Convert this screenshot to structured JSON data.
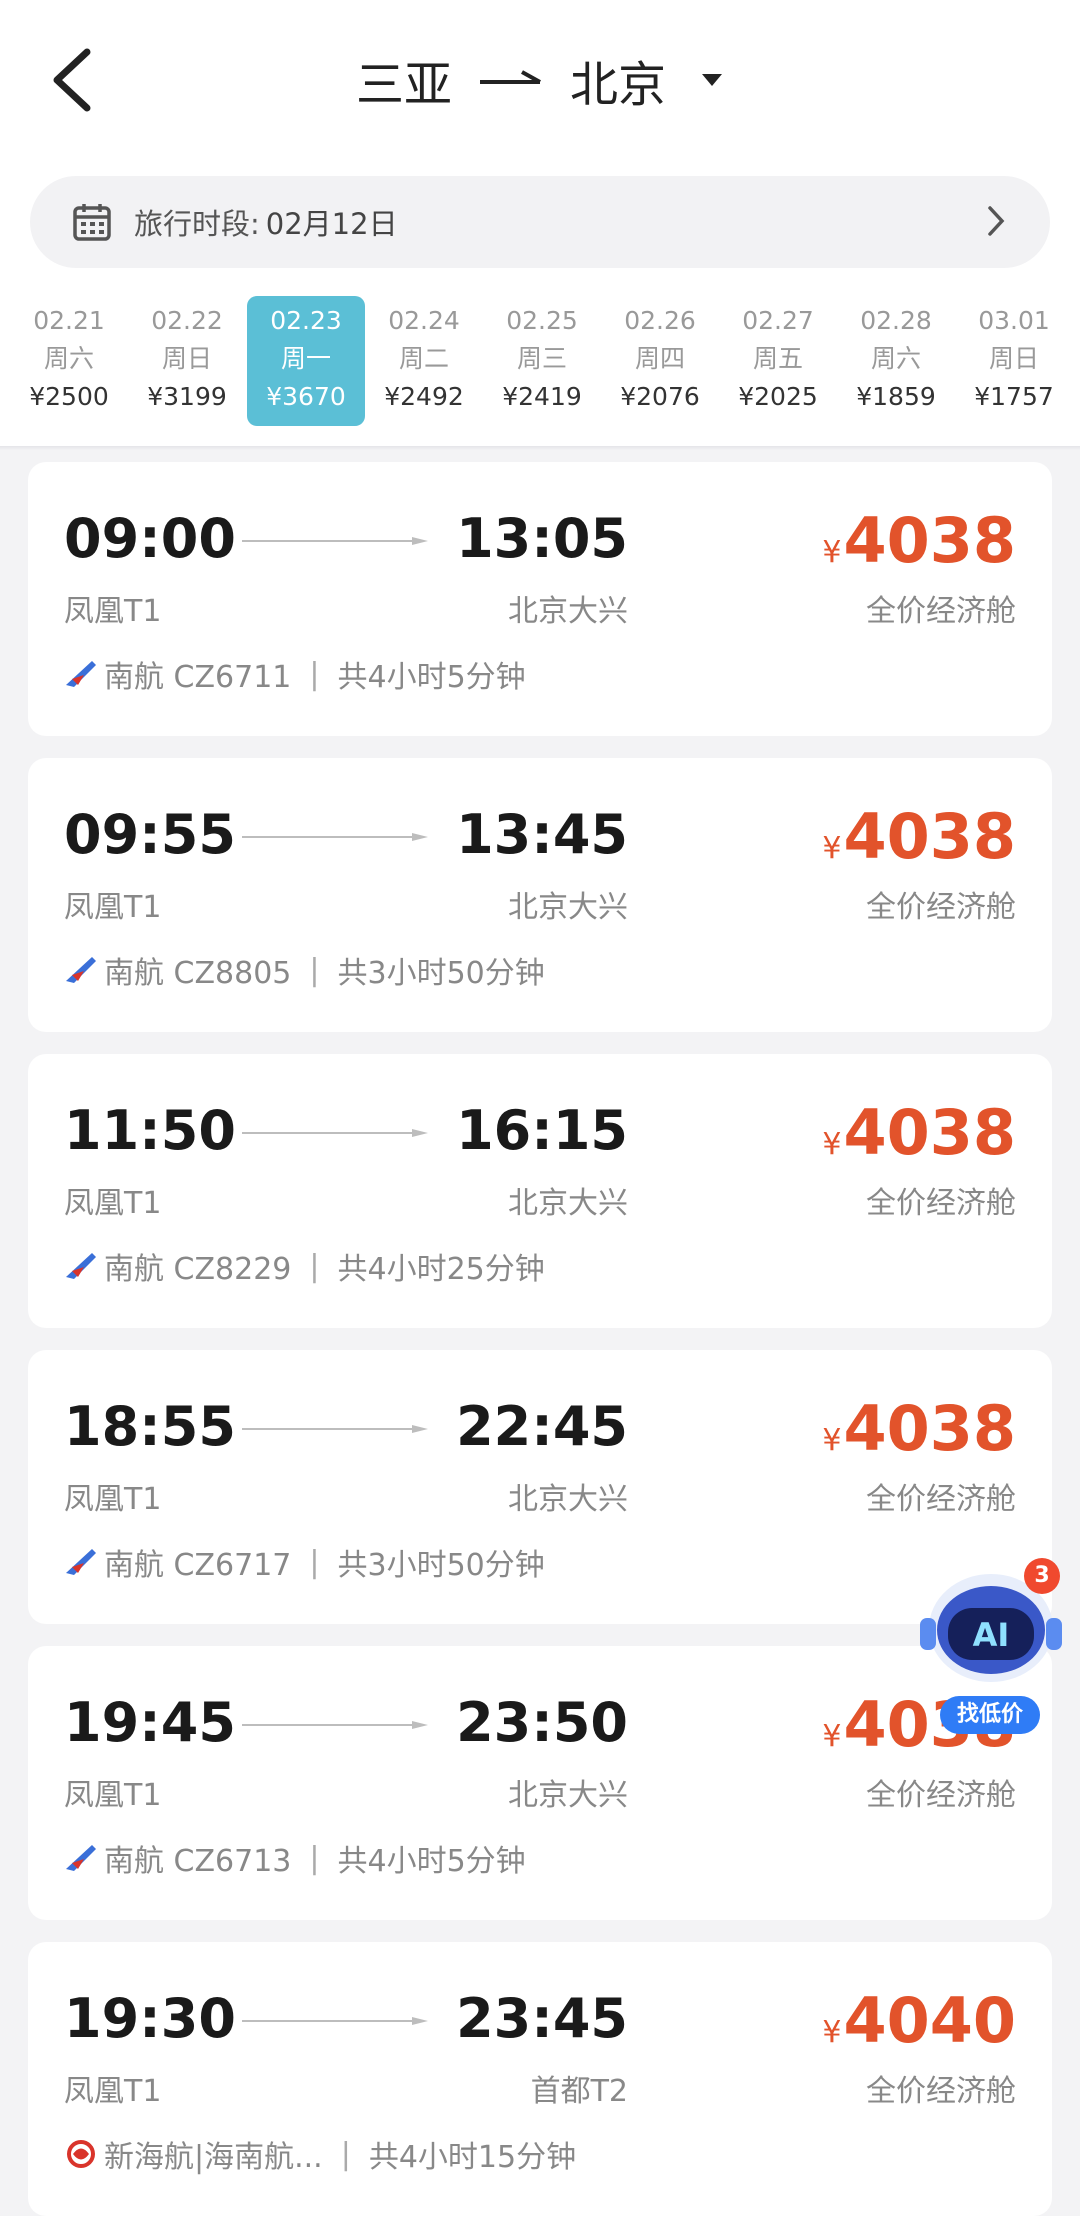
{
  "header": {
    "from": "三亚",
    "to": "北京"
  },
  "period": {
    "label": "旅行时段:",
    "value": "02月12日"
  },
  "dates": [
    {
      "date": "02.21",
      "weekday": "周六",
      "price": "¥2500",
      "selected": false
    },
    {
      "date": "02.22",
      "weekday": "周日",
      "price": "¥3199",
      "selected": false
    },
    {
      "date": "02.23",
      "weekday": "周一",
      "price": "¥3670",
      "selected": true
    },
    {
      "date": "02.24",
      "weekday": "周二",
      "price": "¥2492",
      "selected": false
    },
    {
      "date": "02.25",
      "weekday": "周三",
      "price": "¥2419",
      "selected": false
    },
    {
      "date": "02.26",
      "weekday": "周四",
      "price": "¥2076",
      "selected": false
    },
    {
      "date": "02.27",
      "weekday": "周五",
      "price": "¥2025",
      "selected": false
    },
    {
      "date": "02.28",
      "weekday": "周六",
      "price": "¥1859",
      "selected": false
    },
    {
      "date": "03.01",
      "weekday": "周日",
      "price": "¥1757",
      "selected": false
    }
  ],
  "flights": [
    {
      "dep_time": "09:00",
      "arr_time": "13:05",
      "dep_airport": "凤凰T1",
      "arr_airport": "北京大兴",
      "currency": "¥",
      "price": "4038",
      "cabin": "全价经济舱",
      "airline": "南航 CZ6711",
      "duration": "共4小时5分钟",
      "logo": "china-southern-logo"
    },
    {
      "dep_time": "09:55",
      "arr_time": "13:45",
      "dep_airport": "凤凰T1",
      "arr_airport": "北京大兴",
      "currency": "¥",
      "price": "4038",
      "cabin": "全价经济舱",
      "airline": "南航 CZ8805",
      "duration": "共3小时50分钟",
      "logo": "china-southern-logo"
    },
    {
      "dep_time": "11:50",
      "arr_time": "16:15",
      "dep_airport": "凤凰T1",
      "arr_airport": "北京大兴",
      "currency": "¥",
      "price": "4038",
      "cabin": "全价经济舱",
      "airline": "南航 CZ8229",
      "duration": "共4小时25分钟",
      "logo": "china-southern-logo"
    },
    {
      "dep_time": "18:55",
      "arr_time": "22:45",
      "dep_airport": "凤凰T1",
      "arr_airport": "北京大兴",
      "currency": "¥",
      "price": "4038",
      "cabin": "全价经济舱",
      "airline": "南航 CZ6717",
      "duration": "共3小时50分钟",
      "logo": "china-southern-logo"
    },
    {
      "dep_time": "19:45",
      "arr_time": "23:50",
      "dep_airport": "凤凰T1",
      "arr_airport": "北京大兴",
      "currency": "¥",
      "price": "4038",
      "cabin": "全价经济舱",
      "airline": "南航 CZ6713",
      "duration": "共4小时5分钟",
      "logo": "china-southern-logo"
    },
    {
      "dep_time": "19:30",
      "arr_time": "23:45",
      "dep_airport": "凤凰T1",
      "arr_airport": "首都T2",
      "currency": "¥",
      "price": "4040",
      "cabin": "全价经济舱",
      "airline": "新海航|海南航...",
      "duration": "共4小时15分钟",
      "logo": "hainan-airlines-logo"
    }
  ],
  "ai_assistant": {
    "badge_count": "3",
    "icon_text": "AI",
    "tag": "找低价"
  },
  "colors": {
    "accent": "#5bbfd6",
    "price": "#e2532b",
    "ai_blue": "#2f7cf6",
    "badge": "#f0492e"
  }
}
